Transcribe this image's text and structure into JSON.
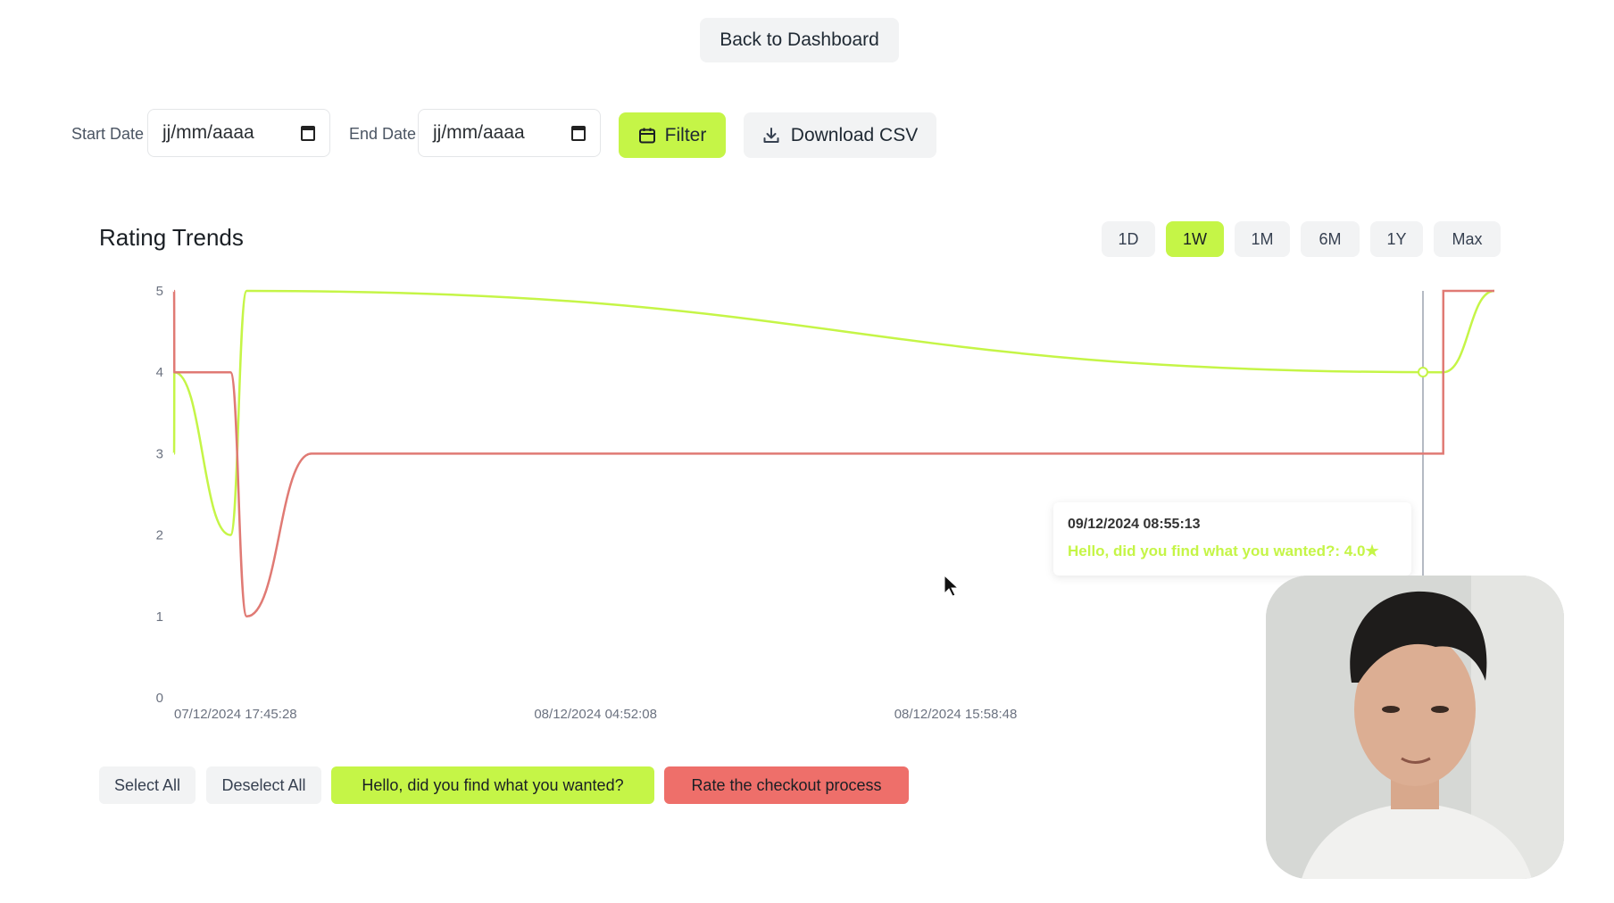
{
  "header": {
    "back_label": "Back to Dashboard"
  },
  "filters": {
    "start_label": "Start Date",
    "start_placeholder": "jj/mm/aaaa",
    "end_label": "End Date",
    "end_placeholder": "jj/mm/aaaa",
    "filter_label": "Filter",
    "download_label": "Download CSV"
  },
  "chart": {
    "title": "Rating Trends",
    "ranges": [
      "1D",
      "1W",
      "1M",
      "6M",
      "1Y",
      "Max"
    ],
    "active_range": "1W",
    "tooltip_time": "09/12/2024 08:55:13",
    "tooltip_value": "Hello, did you find what you wanted?: 4.0★"
  },
  "colors": {
    "accent": "#c5f547",
    "series_a": "#c5f547",
    "series_b": "#e07a74"
  },
  "legend": {
    "select_all": "Select All",
    "deselect_all": "Deselect All",
    "series_a": "Hello, did you find what you wanted?",
    "series_b": "Rate the checkout process"
  },
  "chart_data": {
    "type": "line",
    "ylim": [
      0,
      5
    ],
    "y_ticks": [
      0,
      1,
      2,
      3,
      4,
      5
    ],
    "x_ticks": [
      "07/12/2024 17:45:28",
      "08/12/2024 04:52:08",
      "08/12/2024 15:58:48"
    ],
    "series": [
      {
        "name": "Hello, did you find what you wanted?",
        "x": [
          "07/12/2024 17:45:28",
          "07/12/2024 17:46:00",
          "07/12/2024 19:30:00",
          "07/12/2024 20:00:00",
          "09/12/2024 08:55:13",
          "09/12/2024 10:30:00"
        ],
        "values": [
          3,
          4,
          2,
          5,
          4,
          5
        ]
      },
      {
        "name": "Rate the checkout process",
        "x": [
          "07/12/2024 17:45:28",
          "07/12/2024 17:46:00",
          "07/12/2024 19:30:00",
          "07/12/2024 20:00:00",
          "07/12/2024 22:00:00",
          "09/12/2024 08:55:13",
          "09/12/2024 08:55:30",
          "09/12/2024 10:30:00"
        ],
        "values": [
          5,
          4,
          4,
          1,
          3,
          3,
          5,
          5
        ]
      }
    ]
  }
}
